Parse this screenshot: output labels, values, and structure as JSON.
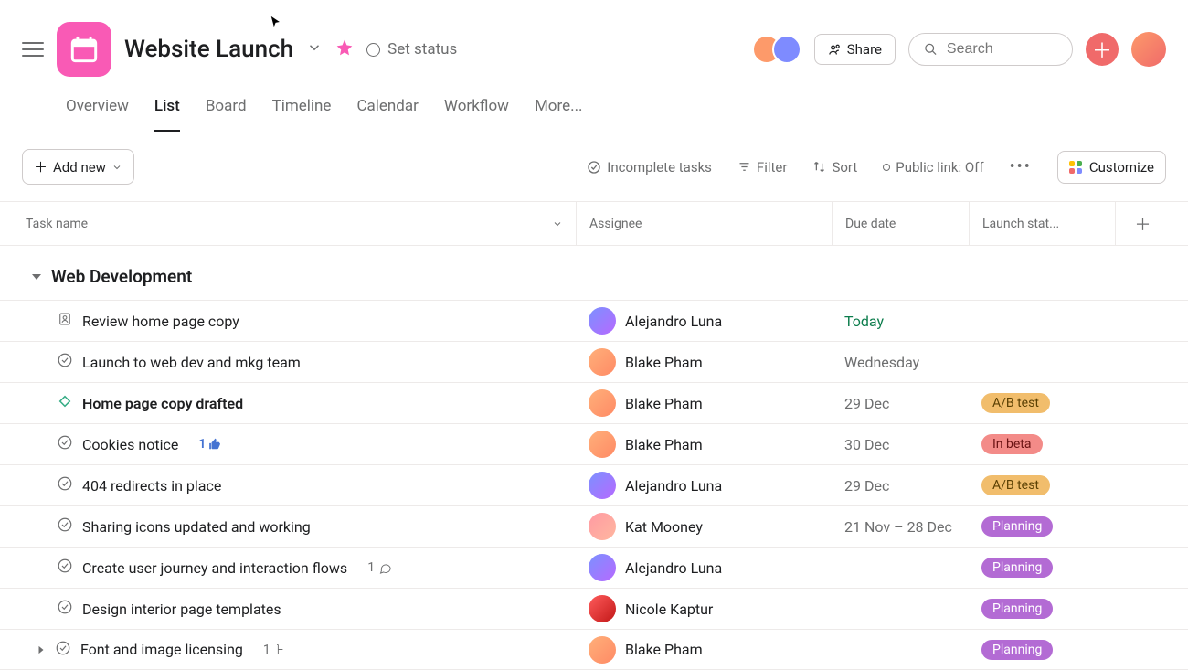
{
  "header": {
    "title": "Website Launch",
    "status_label": "Set status",
    "share_label": "Share",
    "search_placeholder": "Search"
  },
  "tabs": {
    "overview": "Overview",
    "list": "List",
    "board": "Board",
    "timeline": "Timeline",
    "calendar": "Calendar",
    "workflow": "Workflow",
    "more": "More..."
  },
  "toolbar": {
    "add_new": "Add new",
    "incomplete": "Incomplete tasks",
    "filter": "Filter",
    "sort": "Sort",
    "public_link": "Public link: Off",
    "customize": "Customize"
  },
  "columns": {
    "task_name": "Task name",
    "assignee": "Assignee",
    "due_date": "Due date",
    "launch_status": "Launch stat..."
  },
  "section": {
    "name": "Web Development"
  },
  "assignees": {
    "al": "Alejandro Luna",
    "bp": "Blake Pham",
    "km": "Kat Mooney",
    "nk": "Nicole Kaptur"
  },
  "status": {
    "ab": "A/B test",
    "beta": "In beta",
    "plan": "Planning"
  },
  "tasks": [
    {
      "name": "Review home page copy",
      "assignee": "al",
      "due": "Today",
      "due_class": "due-today",
      "status": null,
      "icon": "approval",
      "bold": false
    },
    {
      "name": "Launch to web dev and mkg team",
      "assignee": "bp",
      "due": "Wednesday",
      "due_class": "due-normal",
      "status": null,
      "icon": "check",
      "bold": false
    },
    {
      "name": "Home page copy drafted",
      "assignee": "bp",
      "due": "29 Dec",
      "due_class": "due-normal",
      "status": "ab",
      "icon": "milestone",
      "bold": true
    },
    {
      "name": "Cookies notice",
      "assignee": "bp",
      "due": "30 Dec",
      "due_class": "due-normal",
      "status": "beta",
      "icon": "check",
      "bold": false,
      "likes": "1"
    },
    {
      "name": "404 redirects in place",
      "assignee": "al",
      "due": "29 Dec",
      "due_class": "due-normal",
      "status": "ab",
      "icon": "check",
      "bold": false
    },
    {
      "name": "Sharing icons updated and working",
      "assignee": "km",
      "due": "21 Nov – 28 Dec",
      "due_class": "due-normal",
      "status": "plan",
      "icon": "check",
      "bold": false
    },
    {
      "name": "Create user journey and interaction flows",
      "assignee": "al",
      "due": "",
      "due_class": "due-normal",
      "status": "plan",
      "icon": "check",
      "bold": false,
      "comments": "1"
    },
    {
      "name": "Design interior page templates",
      "assignee": "nk",
      "due": "",
      "due_class": "due-normal",
      "status": "plan",
      "icon": "check",
      "bold": false
    },
    {
      "name": "Font and image licensing",
      "assignee": "bp",
      "due": "",
      "due_class": "due-normal",
      "status": "plan",
      "icon": "check",
      "bold": false,
      "subtasks": "1",
      "has_children": true
    }
  ]
}
